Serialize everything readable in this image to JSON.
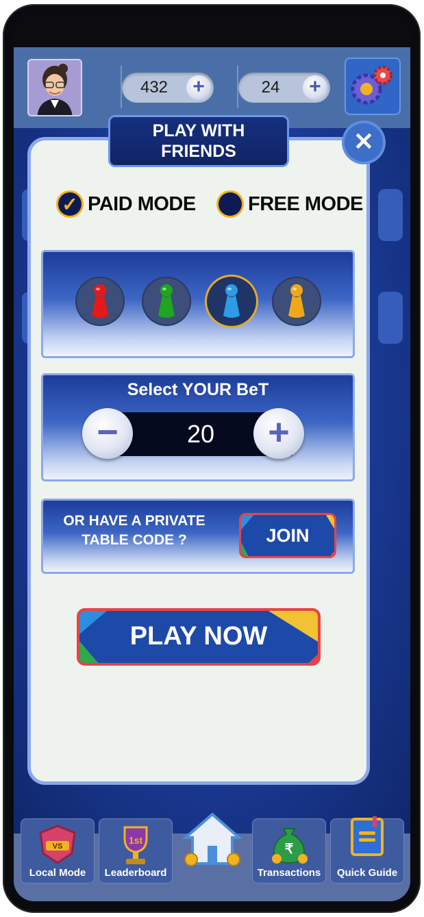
{
  "header": {
    "coins": "432",
    "gems": "24",
    "icons": {
      "avatar": "user-avatar",
      "add": "plus-icon",
      "settings": "gear-icon"
    }
  },
  "modal": {
    "title_line1": "PLAY WITH",
    "title_line2": "FRIENDS",
    "close_icon": "close-icon",
    "modes": {
      "paid_label": "PAID MODE",
      "free_label": "FREE MODE",
      "selected": "paid"
    },
    "tokens": [
      {
        "color": "red",
        "hex": "#e41a1a",
        "selected": false
      },
      {
        "color": "green",
        "hex": "#1fa51f",
        "selected": false
      },
      {
        "color": "blue",
        "hex": "#2e9be6",
        "selected": true
      },
      {
        "color": "yellow",
        "hex": "#f0a81a",
        "selected": false
      }
    ],
    "bet": {
      "title": "Select YOUR BeT",
      "value": "20",
      "decrease_icon": "minus-icon",
      "increase_icon": "plus-icon"
    },
    "private": {
      "line1": "OR HAVE A PRIVATE",
      "line2": "TABLE CODE ?",
      "join_label": "JOIN"
    },
    "play_label": "PLAY NOW"
  },
  "bottom_nav": [
    {
      "label": "Local Mode",
      "icon": "vs-shield-icon"
    },
    {
      "label": "Leaderboard",
      "icon": "trophy-icon"
    },
    {
      "label": "",
      "icon": "home-icon"
    },
    {
      "label": "Transactions",
      "icon": "money-bag-icon"
    },
    {
      "label": "Quick Guide",
      "icon": "book-icon"
    }
  ],
  "colors": {
    "accent": "#f2b21b",
    "modal_bg": "#eef3ee",
    "panel_dark": "#1d3c9b",
    "button_border": "#e84444"
  }
}
